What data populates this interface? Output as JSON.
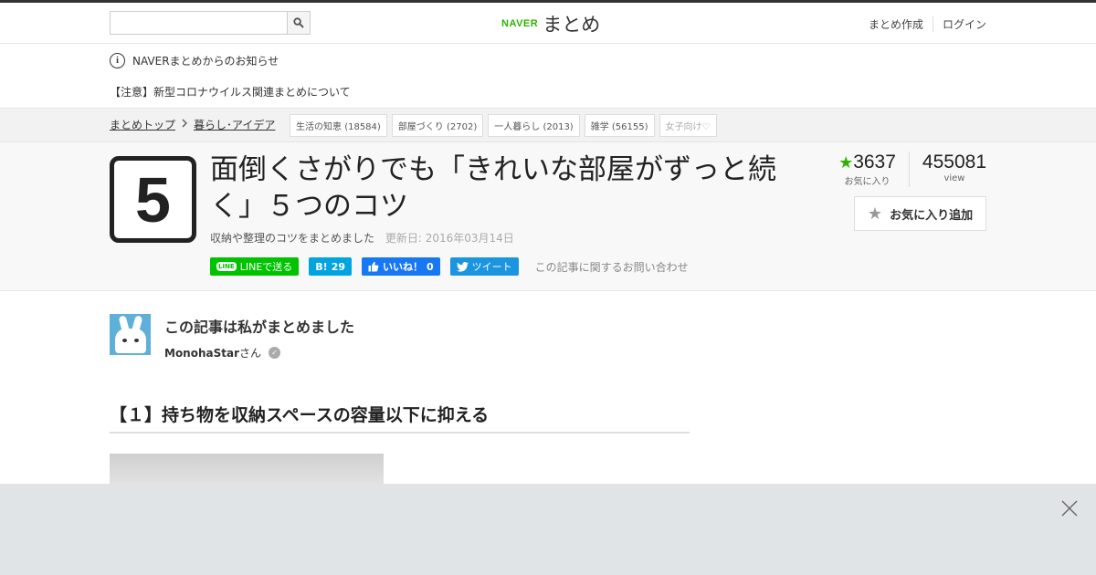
{
  "header": {
    "search_placeholder": "",
    "logo_brand": "NAVER",
    "logo_service": "まとめ",
    "links": [
      "まとめ作成",
      "ログイン"
    ]
  },
  "notice": {
    "info_glyph": "i",
    "title": "NAVERまとめからのお知らせ",
    "link": "【注意】新型コロナウイルス関連まとめについて"
  },
  "breadcrumb": {
    "items": [
      "まとめトップ",
      "暮らし･アイデア"
    ],
    "tags": [
      {
        "label": "生活の知恵",
        "count": "(18584)"
      },
      {
        "label": "部屋づくり",
        "count": "(2702)"
      },
      {
        "label": "一人暮らし",
        "count": "(2013)"
      },
      {
        "label": "雑学",
        "count": "(56155)"
      },
      {
        "label": "女子向け♡",
        "count": ""
      }
    ]
  },
  "article": {
    "thumb_number": "5",
    "title": "面倒くさがりでも「きれいな部屋がずっと続く」５つのコツ",
    "description": "収納や整理のコツをまとめました",
    "updated": "更新日: 2016年03月14日",
    "social": {
      "line_icon": "LINE",
      "line": "LINEで送る",
      "hatena_icon": "B!",
      "hatena_count": "29",
      "fb_label": "いいね！",
      "fb_count": "0",
      "tweet": "ツイート"
    },
    "inquiry": "この記事に関するお問い合わせ",
    "stats": {
      "favorites": "3637",
      "favorites_label": "お気に入り",
      "views": "455081",
      "views_label": "view"
    },
    "fav_button": "お気に入り追加"
  },
  "author": {
    "heading": "この記事は私がまとめました",
    "name": "MonohaStar",
    "suffix": "さん",
    "verified_glyph": "✓"
  },
  "section": {
    "title": "【１】持ち物を収納スペースの容量以下に抑える"
  },
  "colors": {
    "naver_green": "#2db400",
    "line_green": "#00c300",
    "hatena_blue": "#00a4de",
    "facebook_blue": "#1877f2",
    "twitter_blue": "#1b95e0"
  }
}
